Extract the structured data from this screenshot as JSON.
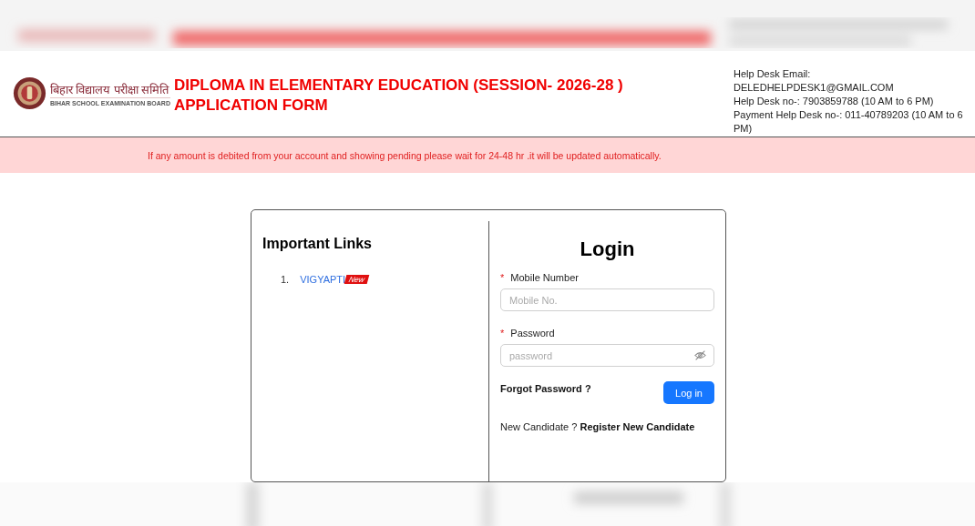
{
  "header": {
    "logo_hindi": "बिहार विद्यालय परीक्षा समिति",
    "logo_english": "BIHAR SCHOOL EXAMINATION BOARD",
    "title": "DIPLOMA IN ELEMENTARY EDUCATION (SESSION- 2026-28 ) APPLICATION FORM",
    "help_desk": [
      "Help Desk Email: DELEDHELPDESK1@GMAIL.COM",
      "Help Desk no-: 7903859788 (10 AM to 6 PM)",
      "Payment Help Desk no-: 011-40789203 (10 AM to 6 PM)"
    ]
  },
  "notice": "If any amount is debited from your account and showing pending please wait for 24-48 hr .it will be updated automatically.",
  "important_links": {
    "title": "Important Links",
    "items": [
      {
        "number": "1.",
        "label": "VIGYAPTI",
        "badge": "New"
      }
    ]
  },
  "login": {
    "title": "Login",
    "required_mark": "*",
    "fields": [
      {
        "label": "Mobile Number",
        "required": true,
        "placeholder": "Mobile No.",
        "kind": "text"
      },
      {
        "label": "Password",
        "required": true,
        "placeholder": "password",
        "kind": "password"
      }
    ],
    "forgot": "Forgot Password ?",
    "submit": "Log in",
    "new_candidate": "New Candidate ?",
    "register": "Register New Candidate"
  }
}
